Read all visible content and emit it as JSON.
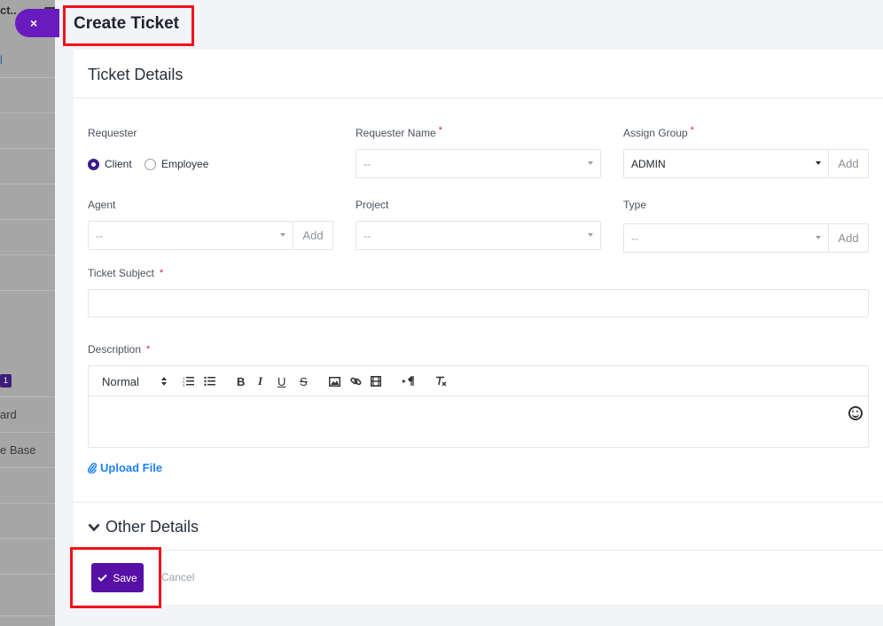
{
  "sidebar": {
    "top_fragment": "ct..",
    "fragments": [
      "l",
      "ard",
      "e Base"
    ],
    "badge": "1"
  },
  "close_button": "×",
  "panel": {
    "title": "Create Ticket"
  },
  "ticket_details": {
    "heading": "Ticket Details",
    "requester": {
      "label": "Requester",
      "options": [
        "Client",
        "Employee"
      ],
      "selected": "Client"
    },
    "requester_name": {
      "label": "Requester Name",
      "value": "--"
    },
    "assign_group": {
      "label": "Assign Group",
      "value": "ADMIN",
      "add": "Add"
    },
    "agent": {
      "label": "Agent",
      "value": "--",
      "add": "Add"
    },
    "project": {
      "label": "Project",
      "value": "--"
    },
    "type": {
      "label": "Type",
      "value": "--",
      "add": "Add"
    },
    "subject": {
      "label": "Ticket Subject",
      "value": ""
    },
    "description": {
      "label": "Description",
      "format": "Normal",
      "tools": [
        "ordered-list",
        "bullet-list",
        "bold",
        "italic",
        "underline",
        "strike",
        "image",
        "link",
        "video",
        "text-direction",
        "clear-format"
      ]
    },
    "upload": "Upload File",
    "required_mark": "*"
  },
  "other_details": "Other Details",
  "actions": {
    "save": "Save",
    "cancel": "Cancel"
  },
  "colors": {
    "accent": "#5710a6",
    "highlight": "#f2121d",
    "link": "#1d82f5"
  }
}
